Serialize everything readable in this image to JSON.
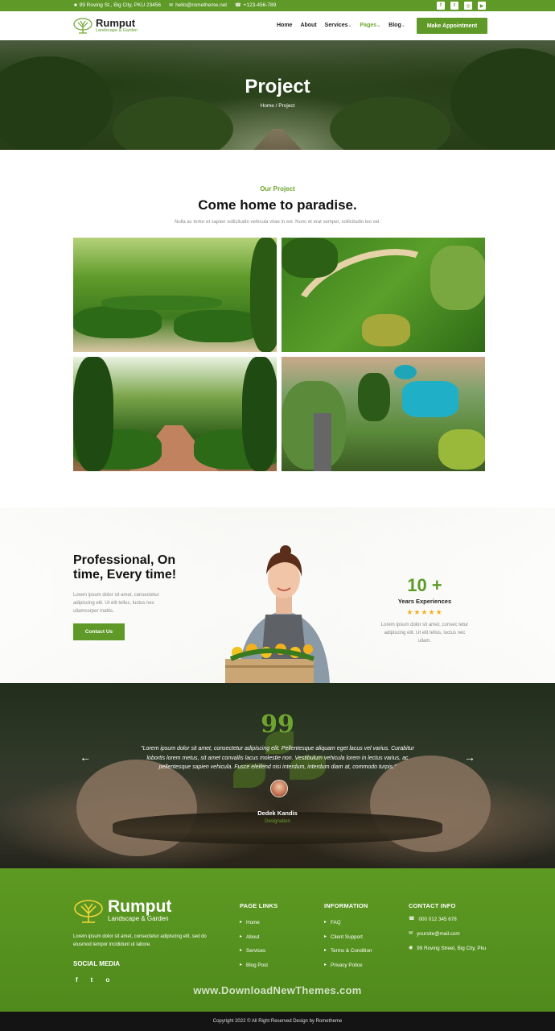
{
  "topbar": {
    "address": "99 Roving St., Big City, PKU 23456",
    "email": "hello@rometheme.net",
    "phone": "+123-456-789",
    "social_icons": [
      "facebook-icon",
      "twitter-icon",
      "instagram-icon",
      "youtube-icon"
    ]
  },
  "brand": {
    "name": "Rumput",
    "tagline": "Landscape & Garden"
  },
  "nav": {
    "items": [
      "Home",
      "About",
      "Services",
      "Pages",
      "Blog"
    ],
    "active": "Pages",
    "cta": "Make Appointment"
  },
  "hero": {
    "title": "Project",
    "breadcrumb": "Home / Project"
  },
  "projects": {
    "kicker": "Our Project",
    "title": "Come home to paradise.",
    "description": "Nulla ac tortor et sapien sollicitudin vehicula vitae in est. Nunc et erat semper, sollicitudin leo vel.",
    "images": [
      "formal-garden-photo",
      "lawn-path-photo",
      "hedge-walkway-photo",
      "gardener-photo"
    ]
  },
  "professional": {
    "title": "Professional, On time, Every time!",
    "text": "Lorem ipsum dolor sit amet, consectetur adipiscing elit. Ut elit tellus, luctus nec ullamcorper mattis.",
    "button": "Contact Us",
    "stat_number": "10 +",
    "stat_label": "Years Experiences",
    "stars": "★★★★★",
    "stat_text": "Lorem ipsum dolor sit amet, consec tetur adipiscing elit. Ut elit tellus, luctus nec ullam."
  },
  "testimonial": {
    "quote_mark": "99",
    "text": "\"Lorem ipsum dolor sit amet, consectetur adipiscing elit. Pellentesque aliquam eget lacus vel varius. Curabitur lobortis lorem metus, sit amet convallis lacus molestie non. Vestibulum vehicula lorem in lectus varius, ac pellentesque sapien vehicula. Fusce eleifend nisi interdum, interdum diam at, commodo turpis.\"",
    "name": "Dedek Kandis",
    "role": "Designation"
  },
  "footer": {
    "about": "Lorem ipsum dolor sit amet, consectetur adipiscing elit, sed do eiusmod tempor incididunt ut labore.",
    "social_title": "SOCIAL MEDIA",
    "social": [
      "f",
      "t",
      "o"
    ],
    "page_links": {
      "title": "PAGE LINKS",
      "items": [
        "Home",
        "About",
        "Services",
        "Blog Post"
      ]
    },
    "information": {
      "title": "INFORMATION",
      "items": [
        "FAQ",
        "Client Support",
        "Terms & Condition",
        "Privacy Police"
      ]
    },
    "contact": {
      "title": "CONTACT INFO",
      "phone": "000 012 345 678",
      "email": "yoursite@mail.com",
      "address": "99 Roving Street, Big City, Pku"
    },
    "watermark": "www.DownloadNewThemes.com",
    "copyright": "Copyright 2022 © All Right Reserved Design by Rometheme"
  },
  "colors": {
    "accent": "#5f9a28",
    "star": "#f2b01e",
    "dark": "#141414"
  }
}
